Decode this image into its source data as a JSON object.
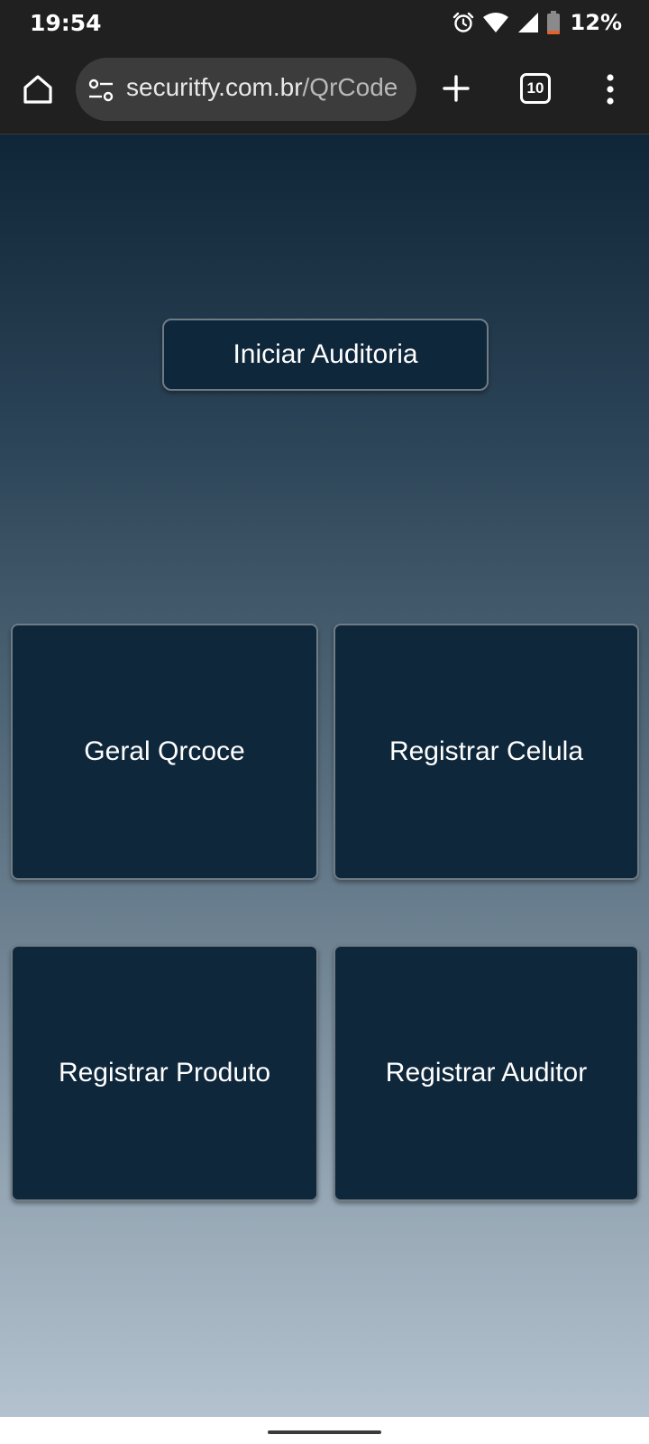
{
  "status_bar": {
    "time": "19:54",
    "battery_percent": "12%",
    "battery_level": 0.12,
    "icons": [
      "alarm-icon",
      "wifi-icon",
      "signal-icon",
      "battery-icon"
    ]
  },
  "browser": {
    "url_host": "securitfy.com.br",
    "url_path": "/QrCode",
    "tab_count": "10",
    "icons": [
      "home-icon",
      "site-settings-icon",
      "plus-icon",
      "tabs-icon",
      "more-vert-icon"
    ]
  },
  "page": {
    "start_button": "Iniciar Auditoria",
    "tiles": [
      {
        "label": "Geral Qrcoce"
      },
      {
        "label": "Registrar Celula"
      },
      {
        "label": "Registrar Produto"
      },
      {
        "label": "Registrar Auditor"
      }
    ]
  },
  "colors": {
    "button_bg": "#0f273b",
    "gradient_top": "#0f2538",
    "gradient_bottom": "#b3c2ce",
    "chrome_bar": "#202020",
    "battery_low": "#e8602c"
  }
}
